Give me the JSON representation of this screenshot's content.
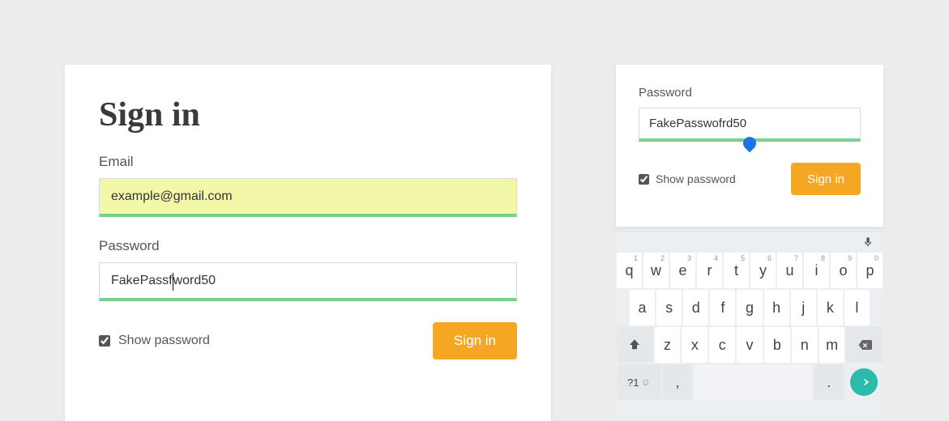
{
  "left": {
    "title": "Sign in",
    "email_label": "Email",
    "email_value": "example@gmail.com",
    "password_label": "Password",
    "password_value_pre": "FakePassf",
    "password_value_post": "word50",
    "show_password_label": "Show password",
    "signin_label": "Sign in"
  },
  "right": {
    "password_label": "Password",
    "password_value": "FakePasswofrd50",
    "show_password_label": "Show password",
    "signin_label": "Sign in"
  },
  "keyboard": {
    "row1": [
      {
        "main": "q",
        "sup": "1"
      },
      {
        "main": "w",
        "sup": "2"
      },
      {
        "main": "e",
        "sup": "3"
      },
      {
        "main": "r",
        "sup": "4"
      },
      {
        "main": "t",
        "sup": "5"
      },
      {
        "main": "y",
        "sup": "6"
      },
      {
        "main": "u",
        "sup": "7"
      },
      {
        "main": "i",
        "sup": "8"
      },
      {
        "main": "o",
        "sup": "9"
      },
      {
        "main": "p",
        "sup": "0"
      }
    ],
    "row2": [
      {
        "main": "a"
      },
      {
        "main": "s"
      },
      {
        "main": "d"
      },
      {
        "main": "f"
      },
      {
        "main": "g"
      },
      {
        "main": "h"
      },
      {
        "main": "j"
      },
      {
        "main": "k"
      },
      {
        "main": "l"
      }
    ],
    "row3": [
      {
        "main": "z"
      },
      {
        "main": "x"
      },
      {
        "main": "c"
      },
      {
        "main": "v"
      },
      {
        "main": "b"
      },
      {
        "main": "n"
      },
      {
        "main": "m"
      }
    ],
    "sym_label": "?1",
    "comma": ",",
    "period": "."
  }
}
